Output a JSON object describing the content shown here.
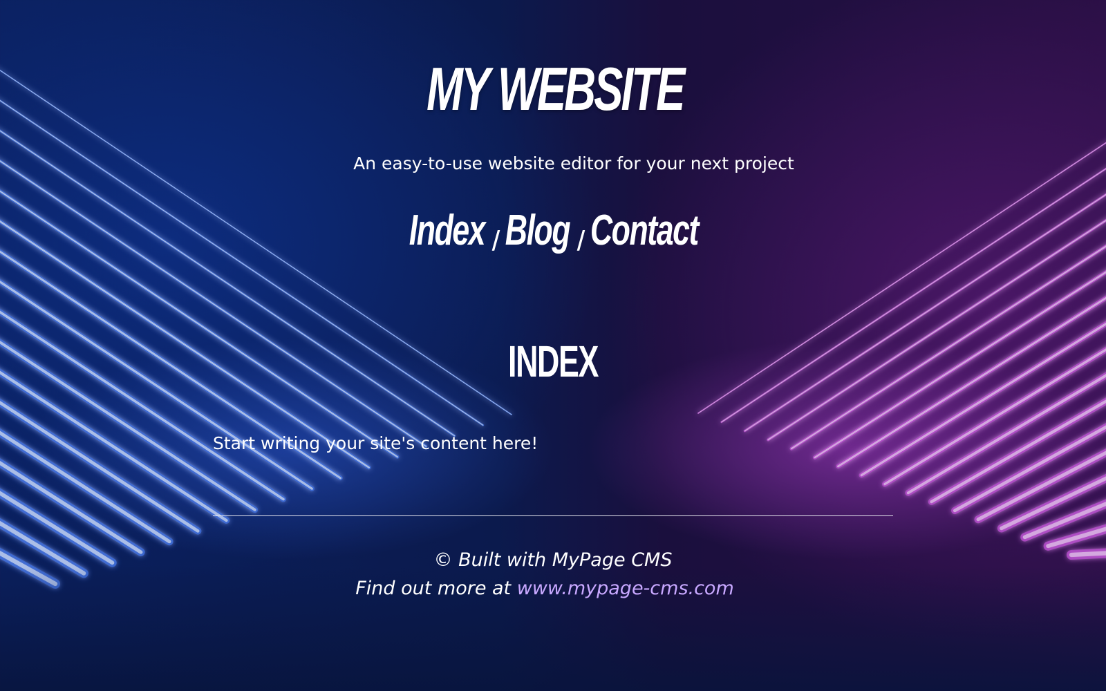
{
  "site": {
    "title": "MY WEBSITE",
    "tagline": "An easy-to-use website editor for your next project"
  },
  "nav": {
    "items": [
      {
        "label": "Index"
      },
      {
        "label": "Blog"
      },
      {
        "label": "Contact"
      }
    ],
    "separator": "/"
  },
  "main": {
    "heading": "INDEX",
    "body": "Start writing your site's content here!"
  },
  "footer": {
    "copyright": "© Built with MyPage CMS",
    "find_out_prefix": "Find out more at ",
    "link_text": "www.mypage-cms.com"
  },
  "colors": {
    "link": "#c8a8ff",
    "text": "#ffffff",
    "left_glow": "#3a6bd8",
    "right_glow": "#b34ac9"
  }
}
